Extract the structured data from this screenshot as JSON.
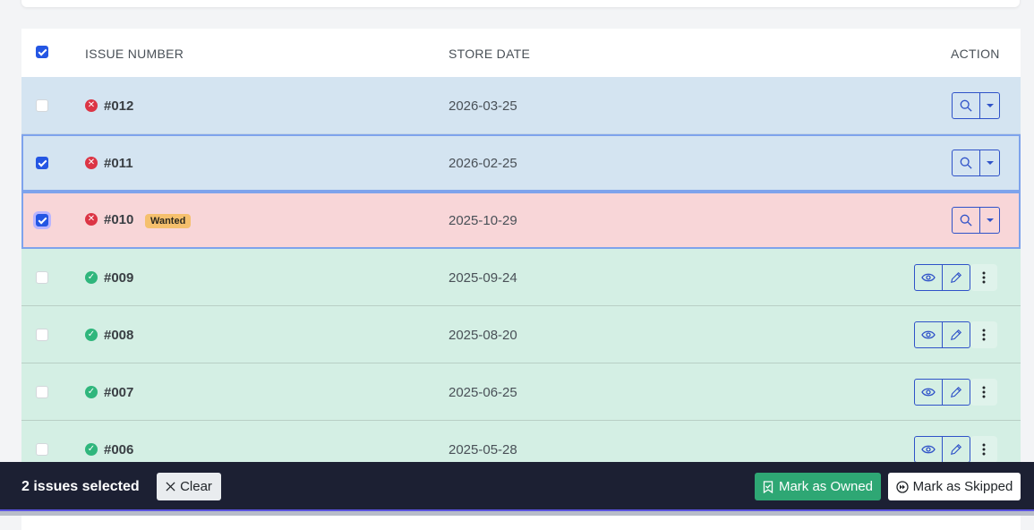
{
  "table": {
    "headers": {
      "issue_number": "ISSUE NUMBER",
      "store_date": "STORE DATE",
      "action": "ACTION"
    },
    "select_all_checked": true,
    "rows": [
      {
        "number": "#012",
        "date": "2026-03-25",
        "status": "missing",
        "status_icon": "x-circle-icon",
        "checked": false,
        "badge": ""
      },
      {
        "number": "#011",
        "date": "2026-02-25",
        "status": "missing",
        "status_icon": "x-circle-icon",
        "checked": true,
        "badge": ""
      },
      {
        "number": "#010",
        "date": "2025-10-29",
        "status": "wanted",
        "status_icon": "x-circle-icon",
        "checked": true,
        "badge": "Wanted"
      },
      {
        "number": "#009",
        "date": "2025-09-24",
        "status": "owned",
        "status_icon": "check-circle-icon",
        "checked": false,
        "badge": ""
      },
      {
        "number": "#008",
        "date": "2025-08-20",
        "status": "owned",
        "status_icon": "check-circle-icon",
        "checked": false,
        "badge": ""
      },
      {
        "number": "#007",
        "date": "2025-06-25",
        "status": "owned",
        "status_icon": "check-circle-icon",
        "checked": false,
        "badge": ""
      },
      {
        "number": "#006",
        "date": "2025-05-28",
        "status": "owned",
        "status_icon": "check-circle-icon",
        "checked": false,
        "badge": ""
      }
    ]
  },
  "bulk_bar": {
    "selected_text": "2 issues selected",
    "clear_label": "Clear",
    "mark_owned_label": "Mark as Owned",
    "mark_skipped_label": "Mark as Skipped"
  },
  "colors": {
    "accent": "#2456e3",
    "missing_row": "#d4e4f1",
    "wanted_row": "#f8d6d8",
    "owned_row": "#d4efe4",
    "owned_button": "#2ea774",
    "bar_bg": "#1c2033"
  }
}
